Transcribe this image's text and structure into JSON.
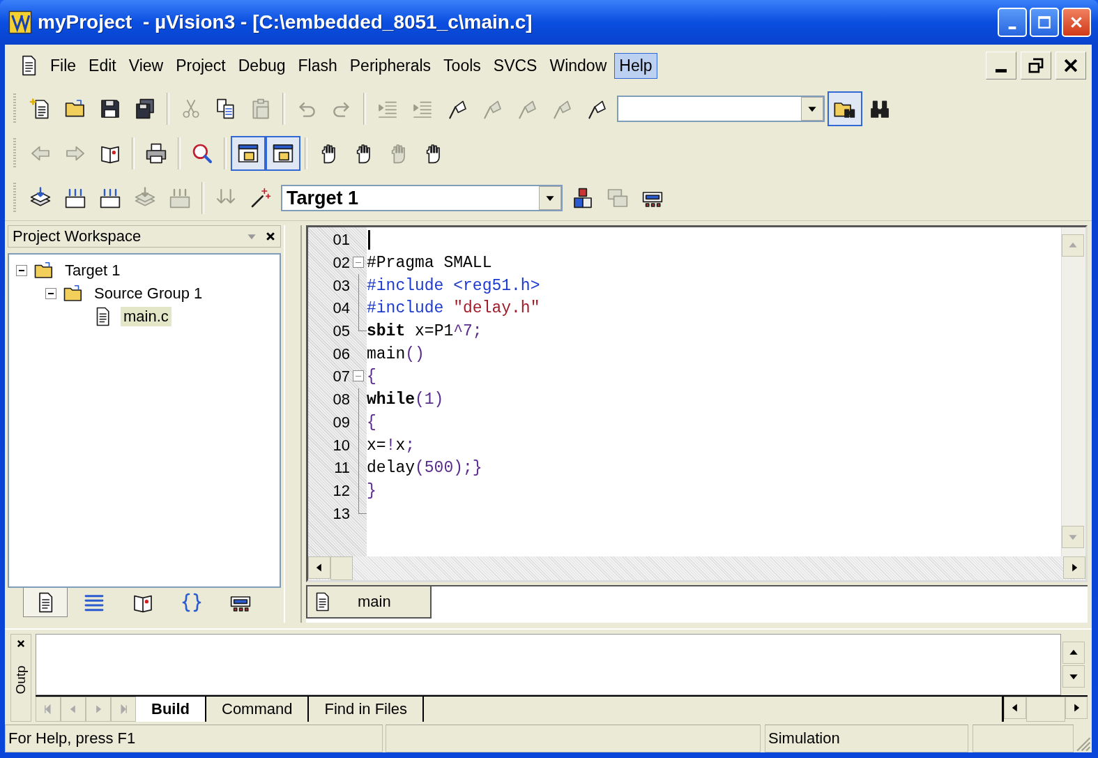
{
  "window": {
    "title": "myProject  - µVision3 - [C:\\embedded_8051_c\\main.c]"
  },
  "menu": [
    {
      "label": "File",
      "selected": false
    },
    {
      "label": "Edit",
      "selected": false
    },
    {
      "label": "View",
      "selected": false
    },
    {
      "label": "Project",
      "selected": false
    },
    {
      "label": "Debug",
      "selected": false
    },
    {
      "label": "Flash",
      "selected": false
    },
    {
      "label": "Peripherals",
      "selected": false
    },
    {
      "label": "Tools",
      "selected": false
    },
    {
      "label": "SVCS",
      "selected": false
    },
    {
      "label": "Window",
      "selected": false
    },
    {
      "label": "Help",
      "selected": true
    }
  ],
  "toolbars": [
    [
      {
        "kind": "button",
        "disabled": false,
        "pressed": false
      },
      {
        "kind": "button",
        "disabled": false,
        "pressed": false
      },
      {
        "kind": "button",
        "disabled": false,
        "pressed": false
      },
      {
        "kind": "button",
        "disabled": false,
        "pressed": false
      },
      {
        "kind": "separator"
      },
      {
        "kind": "button",
        "disabled": true,
        "pressed": false
      },
      {
        "kind": "button",
        "disabled": false,
        "pressed": false
      },
      {
        "kind": "button",
        "disabled": true,
        "pressed": false
      },
      {
        "kind": "separator"
      },
      {
        "kind": "button",
        "disabled": true,
        "pressed": false
      },
      {
        "kind": "button",
        "disabled": true,
        "pressed": false
      },
      {
        "kind": "separator"
      },
      {
        "kind": "button",
        "disabled": true,
        "pressed": false
      },
      {
        "kind": "button",
        "disabled": true,
        "pressed": false
      },
      {
        "kind": "button",
        "disabled": false,
        "pressed": false
      },
      {
        "kind": "button",
        "disabled": true,
        "pressed": false
      },
      {
        "kind": "button",
        "disabled": true,
        "pressed": false
      },
      {
        "kind": "button",
        "disabled": true,
        "pressed": false
      },
      {
        "kind": "button",
        "disabled": false,
        "pressed": false
      },
      {
        "kind": "combo"
      },
      {
        "kind": "button",
        "disabled": false,
        "pressed": true
      },
      {
        "kind": "button",
        "disabled": false,
        "pressed": false
      }
    ],
    [
      {
        "kind": "button",
        "disabled": true,
        "pressed": false
      },
      {
        "kind": "button",
        "disabled": true,
        "pressed": false
      },
      {
        "kind": "button",
        "disabled": false,
        "pressed": false
      },
      {
        "kind": "separator"
      },
      {
        "kind": "button",
        "disabled": false,
        "pressed": false
      },
      {
        "kind": "separator"
      },
      {
        "kind": "button",
        "disabled": false,
        "pressed": false
      },
      {
        "kind": "separator"
      },
      {
        "kind": "button",
        "disabled": false,
        "pressed": true
      },
      {
        "kind": "button",
        "disabled": false,
        "pressed": true
      },
      {
        "kind": "separator"
      },
      {
        "kind": "button",
        "disabled": false,
        "pressed": false
      },
      {
        "kind": "button",
        "disabled": false,
        "pressed": false
      },
      {
        "kind": "button",
        "disabled": true,
        "pressed": false
      },
      {
        "kind": "button",
        "disabled": false,
        "pressed": false
      }
    ],
    [
      {
        "kind": "button",
        "disabled": false,
        "pressed": false
      },
      {
        "kind": "button",
        "disabled": false,
        "pressed": false
      },
      {
        "kind": "button",
        "disabled": false,
        "pressed": false
      },
      {
        "kind": "button",
        "disabled": true,
        "pressed": false
      },
      {
        "kind": "button",
        "disabled": true,
        "pressed": false
      },
      {
        "kind": "separator"
      },
      {
        "kind": "button",
        "disabled": true,
        "pressed": false
      },
      {
        "kind": "button",
        "disabled": false,
        "pressed": false
      },
      {
        "kind": "combo",
        "value": "Target 1"
      },
      {
        "kind": "button",
        "disabled": false,
        "pressed": false
      },
      {
        "kind": "button",
        "disabled": true,
        "pressed": false
      },
      {
        "kind": "button",
        "disabled": false,
        "pressed": false
      }
    ]
  ],
  "workspace": {
    "title": "Project Workspace",
    "tree": [
      {
        "label": "Target 1",
        "expanded": true,
        "selected": false,
        "children": [
          {
            "label": "Source Group 1",
            "expanded": true,
            "selected": false,
            "children": [
              {
                "label": "main.c",
                "selected": true
              }
            ]
          }
        ]
      }
    ],
    "tabs": [
      {
        "selected": true
      },
      {
        "selected": false
      },
      {
        "selected": false
      },
      {
        "selected": false
      },
      {
        "selected": false
      }
    ]
  },
  "editor": {
    "lines": [
      {
        "number": "01",
        "fold_box": false,
        "fold_end": false,
        "cursor": true
      },
      {
        "number": "02",
        "fold_box": true,
        "fold_end": false,
        "cursor": false,
        "tokens": [
          {
            "text": "#Pragma SMALL",
            "kind": "plain"
          }
        ]
      },
      {
        "number": "03",
        "fold_box": false,
        "fold_end": false,
        "cursor": false,
        "tokens": [
          {
            "text": "#include",
            "kind": "directive"
          },
          {
            "text": " <reg51.h>",
            "kind": "directive"
          }
        ]
      },
      {
        "number": "04",
        "fold_box": false,
        "fold_end": false,
        "cursor": false,
        "tokens": [
          {
            "text": "#include",
            "kind": "directive"
          },
          {
            "text": " \"delay.h\"",
            "kind": "string"
          }
        ]
      },
      {
        "number": "05",
        "fold_box": false,
        "fold_end": true,
        "cursor": false,
        "tokens": [
          {
            "text": "sbit",
            "kind": "bold"
          },
          {
            "text": " x=P1",
            "kind": "plain"
          },
          {
            "text": "^7;",
            "kind": "op"
          }
        ]
      },
      {
        "number": "06",
        "fold_box": false,
        "fold_end": false,
        "cursor": false,
        "tokens": [
          {
            "text": "main",
            "kind": "plain"
          },
          {
            "text": "()",
            "kind": "op"
          }
        ]
      },
      {
        "number": "07",
        "fold_box": true,
        "fold_end": false,
        "cursor": false,
        "tokens": [
          {
            "text": "{",
            "kind": "op"
          }
        ]
      },
      {
        "number": "08",
        "fold_box": false,
        "fold_end": false,
        "cursor": false,
        "tokens": [
          {
            "text": "while",
            "kind": "bold"
          },
          {
            "text": "(1)",
            "kind": "op"
          }
        ]
      },
      {
        "number": "09",
        "fold_box": false,
        "fold_end": false,
        "cursor": false,
        "tokens": [
          {
            "text": "{",
            "kind": "op"
          }
        ]
      },
      {
        "number": "10",
        "fold_box": false,
        "fold_end": false,
        "cursor": false,
        "tokens": [
          {
            "text": "x=",
            "kind": "plain"
          },
          {
            "text": "!",
            "kind": "op"
          },
          {
            "text": "x",
            "kind": "plain"
          },
          {
            "text": ";",
            "kind": "op"
          }
        ]
      },
      {
        "number": "11",
        "fold_box": false,
        "fold_end": false,
        "cursor": false,
        "tokens": [
          {
            "text": "delay",
            "kind": "plain"
          },
          {
            "text": "(500);}",
            "kind": "op"
          }
        ]
      },
      {
        "number": "12",
        "fold_box": false,
        "fold_end": false,
        "cursor": false,
        "tokens": [
          {
            "text": "}",
            "kind": "op"
          }
        ]
      },
      {
        "number": "13",
        "fold_box": false,
        "fold_end": true,
        "cursor": false
      }
    ],
    "tabs": [
      {
        "label": "main",
        "selected": true
      }
    ]
  },
  "output": {
    "label": "Outp",
    "tabs": [
      {
        "label": "Build",
        "selected": true
      },
      {
        "label": "Command",
        "selected": false
      },
      {
        "label": "Find in Files",
        "selected": false
      }
    ]
  },
  "status_bar": {
    "help": "For Help, press F1",
    "mode": "Simulation"
  }
}
